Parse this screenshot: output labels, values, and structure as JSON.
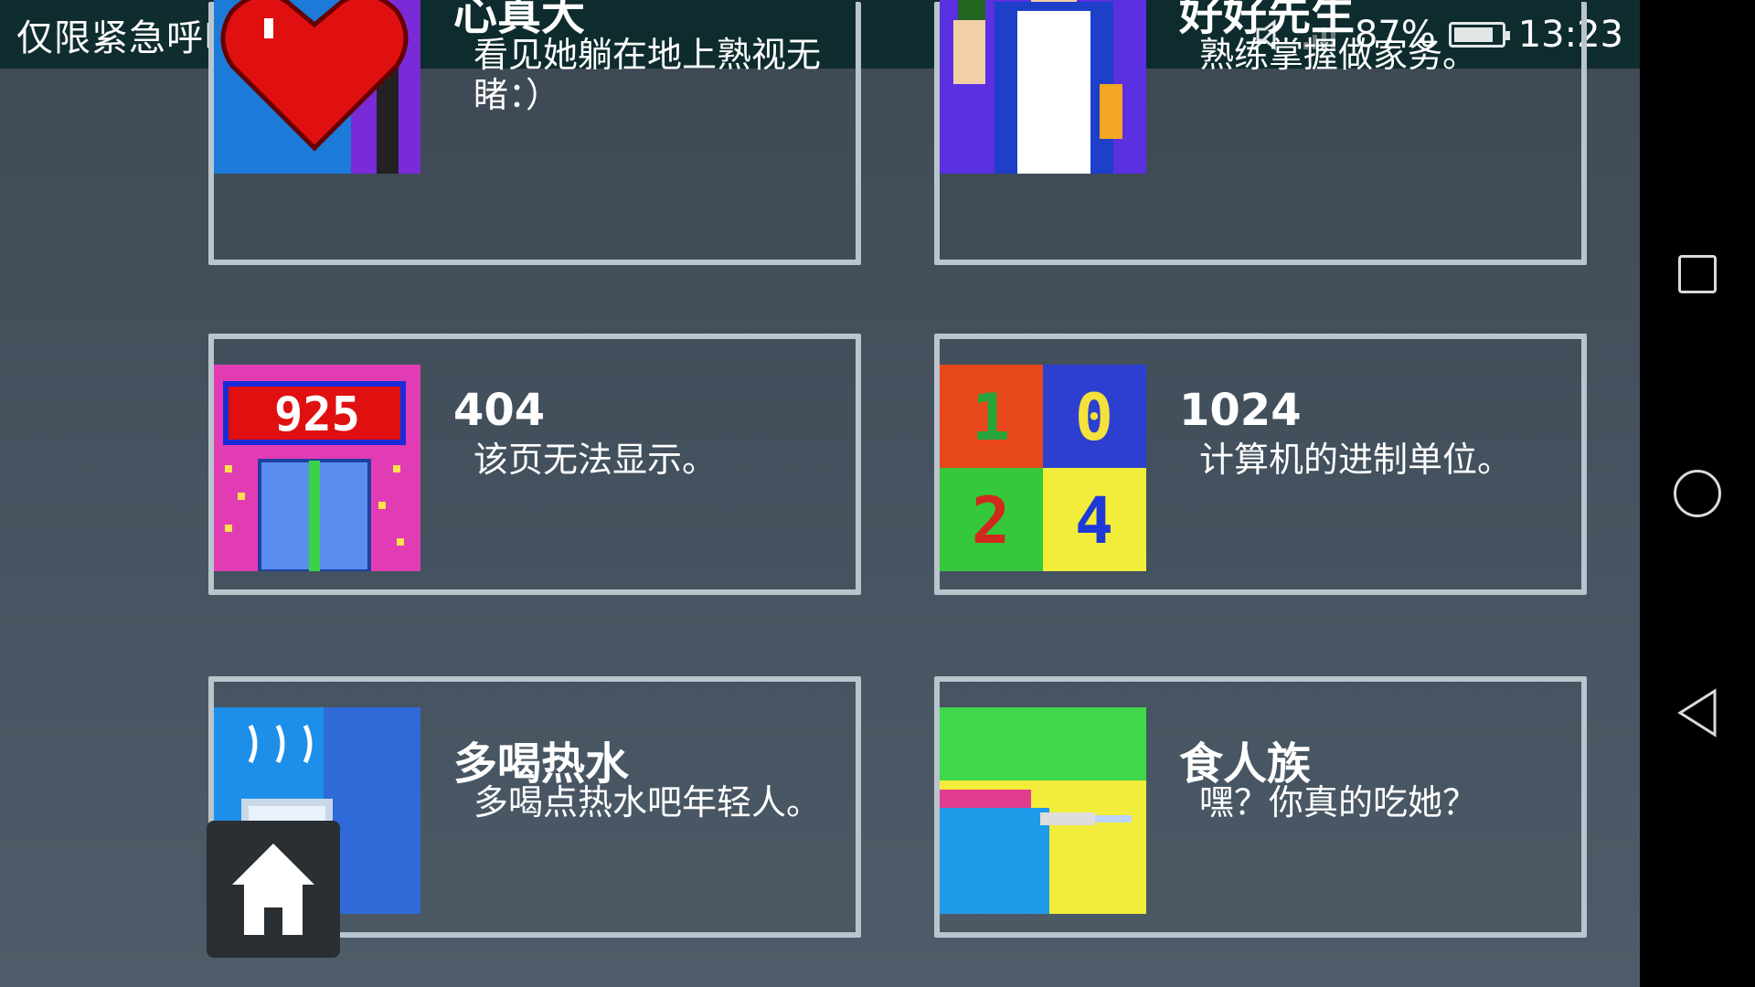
{
  "status_bar": {
    "title": "仅限紧急呼叫",
    "battery_percent": "87%",
    "time": "13:23",
    "icons": [
      "star-badge-icon",
      "image-icon",
      "mute-icon",
      "no-signal-icon",
      "battery-icon"
    ]
  },
  "cards": [
    {
      "name": "心真大",
      "desc": "看见她躺在地上熟视无睹：）"
    },
    {
      "name": "好好先生",
      "desc": "熟练掌握做家务。"
    },
    {
      "name": "404",
      "desc": "该页无法显示。"
    },
    {
      "name": "1024",
      "desc": "计算机的进制单位。"
    },
    {
      "name": "多喝热水",
      "desc": "多喝点热水吧年轻人。"
    },
    {
      "name": "食人族",
      "desc": "嘿？你真的吃她？"
    }
  ],
  "thumb_text": {
    "counter": "925",
    "binary_digits": [
      "1",
      "0",
      "2",
      "4"
    ]
  },
  "nav": {
    "icons": [
      "recent-apps-icon",
      "home-circle-icon",
      "back-icon"
    ]
  },
  "colors": {
    "status_bg": "#0f2d2f",
    "card_border": "#b9c4cc",
    "background": "#45525e"
  }
}
